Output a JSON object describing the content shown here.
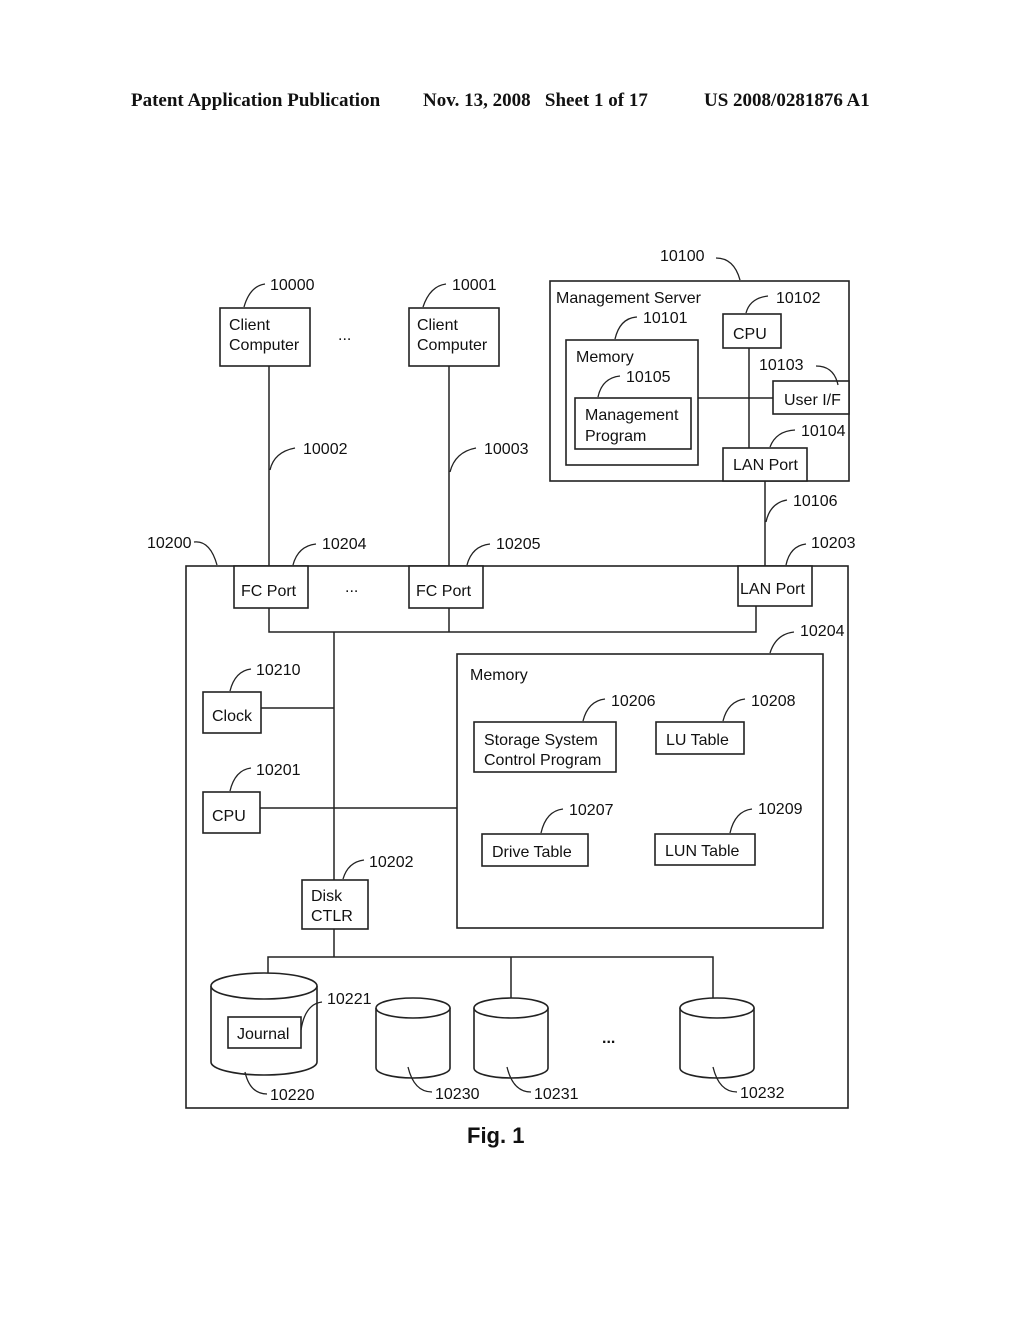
{
  "header": {
    "publication": "Patent Application Publication",
    "date_sheet": "Nov. 13, 2008   Sheet 1 of 17",
    "number": "US 2008/0281876 A1"
  },
  "figure_label": "Fig. 1",
  "clients": [
    {
      "ref": "10000",
      "line1": "Client",
      "line2": "Computer",
      "link_ref": "10002"
    },
    {
      "ref": "10001",
      "line1": "Client",
      "line2": "Computer",
      "link_ref": "10003"
    }
  ],
  "ellipsis": "...",
  "management_server": {
    "ref": "10100",
    "title": "Management Server",
    "memory": {
      "ref": "10101",
      "label": "Memory"
    },
    "program": {
      "ref": "10105",
      "line1": "Management",
      "line2": "Program"
    },
    "cpu": {
      "ref": "10102",
      "label": "CPU"
    },
    "user_if": {
      "ref": "10103",
      "label": "User I/F"
    },
    "lan_port": {
      "ref": "10104",
      "label": "LAN Port"
    },
    "link_ref": "10106"
  },
  "storage_system": {
    "ref": "10200",
    "fc_port_1": {
      "ref": "10204",
      "label": "FC Port"
    },
    "fc_port_2": {
      "ref": "10205",
      "label": "FC Port"
    },
    "lan_port": {
      "ref": "10203",
      "label": "LAN Port"
    },
    "memory": {
      "ref": "10204",
      "label": "Memory"
    },
    "control_program": {
      "ref": "10206",
      "line1": "Storage System",
      "line2": "Control Program"
    },
    "lu_table": {
      "ref": "10208",
      "label": "LU Table"
    },
    "drive_table": {
      "ref": "10207",
      "label": "Drive Table"
    },
    "lun_table": {
      "ref": "10209",
      "label": "LUN Table"
    },
    "clock": {
      "ref": "10210",
      "label": "Clock"
    },
    "cpu": {
      "ref": "10201",
      "label": "CPU"
    },
    "disk_ctlr": {
      "ref": "10202",
      "line1": "Disk",
      "line2": "CTLR"
    },
    "journal_disk": {
      "ref": "10220"
    },
    "journal": {
      "ref": "10221",
      "label": "Journal"
    },
    "disks": [
      {
        "ref": "10230"
      },
      {
        "ref": "10231"
      },
      {
        "ref": "10232"
      }
    ]
  }
}
